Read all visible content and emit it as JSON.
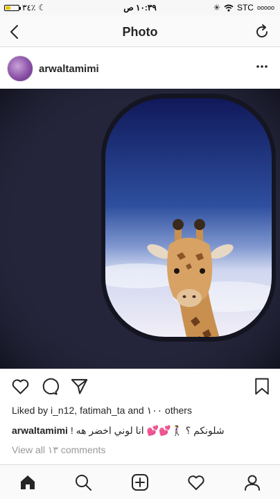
{
  "status_bar": {
    "battery": "٣٤٪",
    "time": "١٠:٣٩ ص",
    "carrier": "STC",
    "signal": "ooooo"
  },
  "nav": {
    "title": "Photo",
    "back_icon": "chevron-left-icon",
    "refresh_icon": "refresh-icon"
  },
  "post": {
    "username": "arwaltamimi",
    "more_icon": "more-horizontal-icon",
    "likes_text": "Liked by i_n12, fatimah_ta and ١٠٠ others",
    "caption_user": "arwaltamimi",
    "caption_text": "! شلونكم ؟ 🚶‍♀️💕💕 انا لوني اخضر هه",
    "view_comments": "View all ١٣ comments"
  },
  "tabs": [
    "home-icon",
    "search-icon",
    "add-icon",
    "heart-icon",
    "profile-icon"
  ],
  "colors": {
    "text": "#262626",
    "muted": "#999999",
    "border": "#dbdbdb",
    "bar_bg": "#fafafa"
  }
}
